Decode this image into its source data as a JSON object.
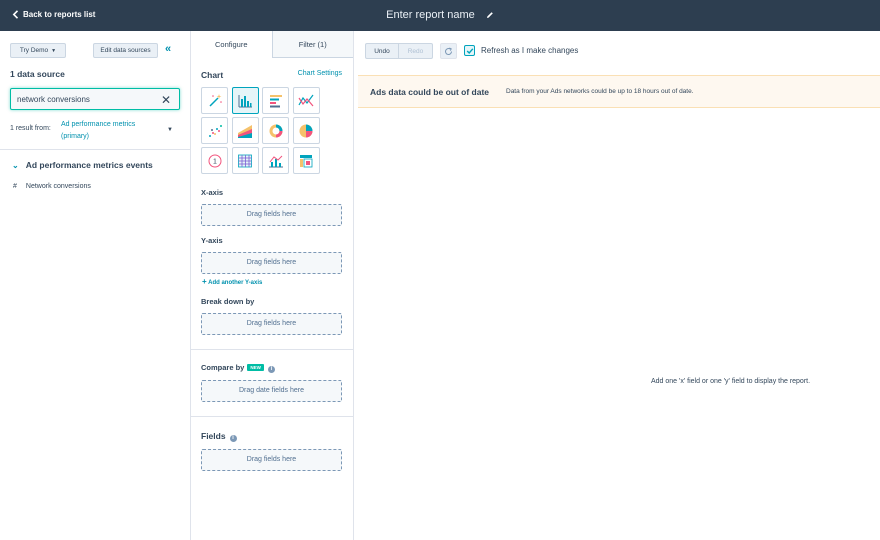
{
  "topbar": {
    "back_label": "Back to reports list",
    "report_name": "Enter report name"
  },
  "sidebar": {
    "try_demo_label": "Try Demo",
    "edit_data_sources_label": "Edit data sources",
    "data_source_count": "1 data source",
    "search_value": "network conversions",
    "result_prefix": "1 result from:",
    "result_source": "Ad performance metrics (primary)",
    "group_label": "Ad performance metrics events",
    "fields": [
      {
        "type_icon": "#",
        "label": "Network conversions"
      }
    ]
  },
  "config": {
    "tabs": [
      {
        "label": "Configure",
        "active": true
      },
      {
        "label": "Filter (1)",
        "active": false
      }
    ],
    "chart_label": "Chart",
    "chart_settings_label": "Chart Settings",
    "chart_types": [
      {
        "icon": "wand-icon",
        "selected": false
      },
      {
        "icon": "column-chart-icon",
        "selected": true
      },
      {
        "icon": "bar-chart-icon",
        "selected": false
      },
      {
        "icon": "line-chart-icon",
        "selected": false
      },
      {
        "icon": "scatter-chart-icon",
        "selected": false
      },
      {
        "icon": "area-chart-icon",
        "selected": false
      },
      {
        "icon": "donut-chart-icon",
        "selected": false
      },
      {
        "icon": "pie-chart-icon",
        "selected": false
      },
      {
        "icon": "summary-icon",
        "selected": false
      },
      {
        "icon": "table-icon",
        "selected": false
      },
      {
        "icon": "combo-chart-icon",
        "selected": false
      },
      {
        "icon": "pivot-table-icon",
        "selected": false
      }
    ],
    "x_axis_label": "X-axis",
    "y_axis_label": "Y-axis",
    "break_down_label": "Break down by",
    "compare_label": "Compare by",
    "new_badge": "NEW",
    "fields_label": "Fields",
    "drag_fields": "Drag fields here",
    "drag_date_fields": "Drag date fields here",
    "add_y_axis": "Add another Y-axis"
  },
  "toolbar": {
    "undo_label": "Undo",
    "redo_label": "Redo",
    "refresh_label": "Refresh as I make changes",
    "refresh_checked": true
  },
  "alert": {
    "title": "Ads data could be out of date",
    "message": "Data from your Ads networks could be up to 18 hours out of date."
  },
  "preview": {
    "empty_message": "Add one 'x' field or one 'y' field to display the report."
  },
  "colors": {
    "topbar_bg": "#2d3e50",
    "accent": "#0091ae",
    "teal": "#00bda5",
    "alert_bg": "#fef8f0",
    "text": "#33475b"
  }
}
